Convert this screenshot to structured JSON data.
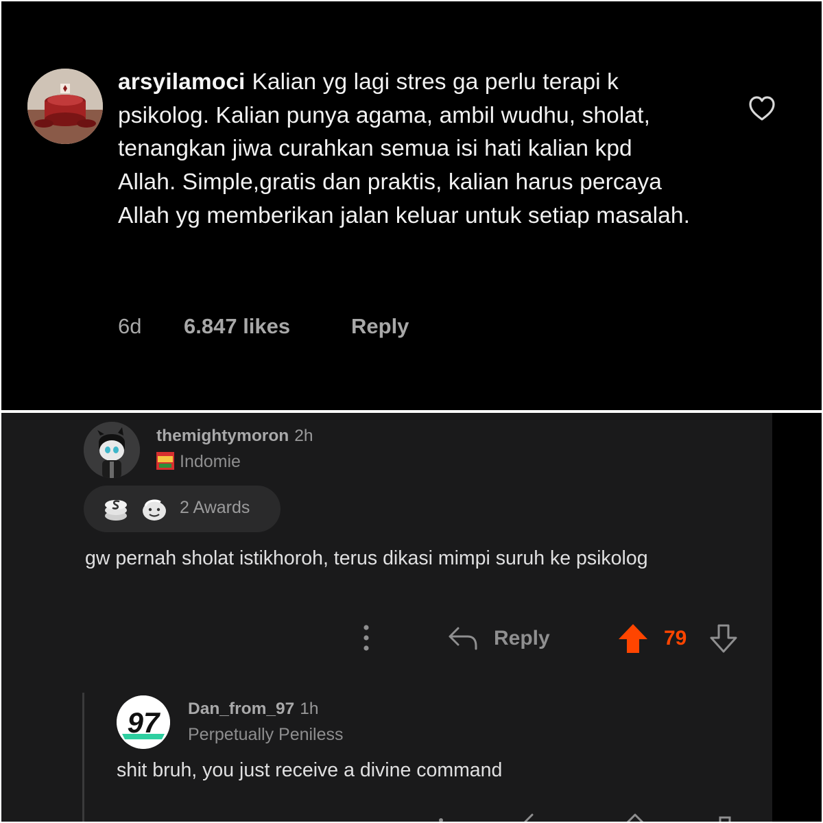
{
  "instagram": {
    "username": "arsyilamoci",
    "comment_text": "Kalian yg lagi stres ga perlu terapi k psikolog. Kalian punya agama, ambil wudhu, sholat, tenangkan jiwa curahkan semua isi hati kalian kpd Allah. Simple,gratis dan praktis, kalian harus percaya Allah yg memberikan jalan keluar untuk setiap masalah.",
    "age": "6d",
    "likes": "6.847 likes",
    "reply_label": "Reply",
    "icons": {
      "like": "heart-icon"
    },
    "colors": {
      "background": "#000000",
      "text": "#f2f2f2",
      "meta": "#a8a8a8"
    }
  },
  "reddit": {
    "comment": {
      "username": "themightymoron",
      "age": "2h",
      "flair": "Indomie",
      "awards_label": "2 Awards",
      "body": "gw pernah sholat istikhoroh, terus dikasi mimpi suruh ke psikolog",
      "reply_label": "Reply",
      "score": "79",
      "upvoted": true
    },
    "reply": {
      "username": "Dan_from_97",
      "age": "1h",
      "flair": "Perpetually Peniless",
      "avatar_text": "97",
      "body": "shit bruh, you just receive a divine command"
    },
    "icons": {
      "more": "more-vertical-icon",
      "reply": "reply-arrow-icon",
      "upvote": "upvote-arrow-icon",
      "downvote": "downvote-arrow-icon",
      "awards": [
        "silver-coin-award-icon",
        "wholesome-award-icon"
      ]
    },
    "colors": {
      "background": "#1a1a1b",
      "upvote": "#ff4500",
      "text": "#e0e0e1",
      "muted": "#8f8f90"
    }
  }
}
